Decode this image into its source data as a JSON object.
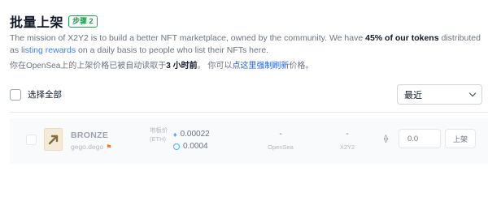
{
  "header": {
    "title": "批量上架",
    "step_badge": "步骤 2"
  },
  "description": {
    "part1": "The mission of X2Y2 is to build a better NFT marketplace, owned by the community. We have ",
    "bold": "45% of our tokens",
    "part2": " distributed as ",
    "link": "listing rewards",
    "part3": " on a daily basis to people who list their NFTs here."
  },
  "note": {
    "part1": "你在OpenSea上的上架价格已被自动读取于",
    "bold": "3 小时前",
    "part2": "。 你可以",
    "link": "点这里强制刷新",
    "part3": "价格。"
  },
  "select_all_label": "选择全部",
  "sort_select": {
    "value": "最近"
  },
  "rows": [
    {
      "name": "BRONZE",
      "collection": "gego.dego",
      "floor_label": "地板价 (ETH)",
      "price_top": "0.00022",
      "price_bottom": "0.0004",
      "opensea_value": "-",
      "opensea_label": "OpenSea",
      "x2y2_value": "-",
      "x2y2_label": "X2Y2",
      "price_placeholder": "0.0",
      "list_button": "上架"
    }
  ],
  "icons": {
    "eth": "eth-icon",
    "coin": "coin-icon",
    "flag": "flag-icon",
    "chevron": "chevron-down-icon"
  }
}
